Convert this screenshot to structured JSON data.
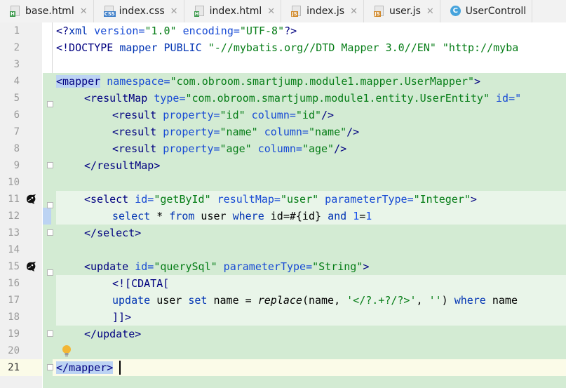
{
  "tabs": [
    {
      "label": "base.html",
      "type": "html",
      "icon": "html-file-icon"
    },
    {
      "label": "index.css",
      "type": "css",
      "icon": "css-file-icon"
    },
    {
      "label": "index.html",
      "type": "html",
      "icon": "html-file-icon"
    },
    {
      "label": "index.js",
      "type": "js",
      "icon": "js-file-icon"
    },
    {
      "label": "user.js",
      "type": "js",
      "icon": "js-file-icon"
    },
    {
      "label": "UserControll",
      "type": "class",
      "icon": "class-icon"
    }
  ],
  "line_numbers": [
    "1",
    "2",
    "3",
    "4",
    "5",
    "6",
    "7",
    "8",
    "9",
    "10",
    "11",
    "12",
    "13",
    "14",
    "15",
    "16",
    "17",
    "18",
    "19",
    "20",
    "21"
  ],
  "current_line": "21",
  "code": {
    "l1": {
      "a": "<?",
      "b": "xml",
      "c": " version=",
      "d": "\"1.0\"",
      "e": " encoding=",
      "f": "\"UTF-8\"",
      "g": "?>"
    },
    "l2": {
      "a": "<!DOCTYPE ",
      "b": "mapper PUBLIC ",
      "c": "\"-//mybatis.org//DTD Mapper 3.0//EN\" \"http://myba"
    },
    "l4": {
      "a": "<",
      "b": "mapper",
      "c": " namespace=",
      "d": "\"com.obroom.smartjump.module1.mapper.UserMapper\"",
      "e": ">"
    },
    "l5": {
      "a": "<",
      "b": "resultMap",
      "c": " type=",
      "d": "\"com.obroom.smartjump.module1.entity.UserEntity\"",
      "e": " id=\""
    },
    "l6": {
      "a": "<",
      "b": "result",
      "c": " property=",
      "d": "\"id\"",
      "e": " column=",
      "f": "\"id\"",
      "g": "/>"
    },
    "l7": {
      "a": "<",
      "b": "result",
      "c": " property=",
      "d": "\"name\"",
      "e": " column=",
      "f": "\"name\"",
      "g": "/>"
    },
    "l8": {
      "a": "<",
      "b": "result",
      "c": " property=",
      "d": "\"age\"",
      "e": " column=",
      "f": "\"age\"",
      "g": "/>"
    },
    "l9": {
      "a": "</",
      "b": "resultMap",
      "c": ">"
    },
    "l11": {
      "a": "<",
      "b": "select",
      "c": " id=",
      "d": "\"getById\"",
      "e": " resultMap=",
      "f": "\"user\"",
      "g": " parameterType=",
      "h": "\"Integer\"",
      "i": ">"
    },
    "l12": {
      "a": "select",
      "b": " * ",
      "c": "from",
      "d": " user ",
      "e": "where",
      "f": " id=#{id} ",
      "g": "and",
      "h": " ",
      "i": "1",
      "j": "=",
      "k": "1"
    },
    "l13": {
      "a": "</",
      "b": "select",
      "c": ">"
    },
    "l15": {
      "a": "<",
      "b": "update",
      "c": " id=",
      "d": "\"querySql\"",
      "e": " parameterType=",
      "f": "\"String\"",
      "g": ">"
    },
    "l16": {
      "a": "<![CDATA["
    },
    "l17": {
      "a": "update",
      "b": " user ",
      "c": "set",
      "d": " name = ",
      "e": "replace",
      "f": "(name, ",
      "g": "'</?.+?/?>'",
      "h": ", ",
      "i": "''",
      "j": ") ",
      "k": "where",
      "l": " name"
    },
    "l18": {
      "a": "]]>"
    },
    "l19": {
      "a": "</",
      "b": "update",
      "c": ">"
    },
    "l21": {
      "a": "</",
      "b": "mapper",
      "c": ">"
    }
  },
  "colors": {
    "keyword": "#0033b3",
    "tag": "#000080",
    "attribute": "#174ad4",
    "string": "#067d17",
    "number": "#1750eb",
    "injected_bg": "#d3ebd3"
  }
}
